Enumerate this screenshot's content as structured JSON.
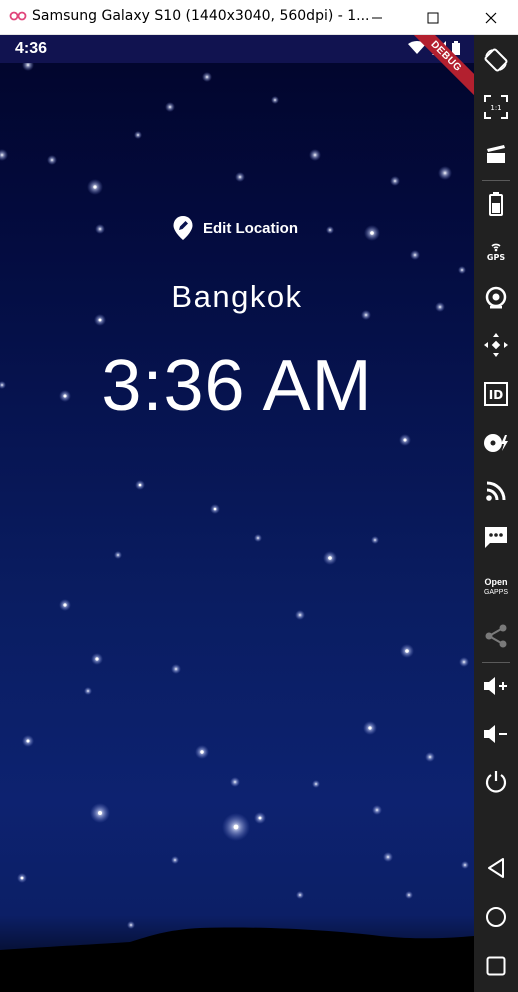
{
  "window": {
    "title": "Samsung Galaxy S10 (1440x3040, 560dpi) - 1...",
    "minimize_icon": "minimize-icon",
    "maximize_icon": "maximize-icon",
    "close_icon": "close-icon"
  },
  "status_bar": {
    "time": "4:36",
    "icons": [
      "wifi-icon",
      "signal-icon",
      "battery-icon"
    ],
    "debug_banner": "DEBUG",
    "debug_color": "#b3202f"
  },
  "app": {
    "edit_location_label": "Edit Location",
    "city": "Bangkok",
    "time": "3:36 AM",
    "background_colors": [
      "#02052b",
      "#0d2270"
    ]
  },
  "toolbar": {
    "items": [
      {
        "name": "rotate",
        "icon": "rotate-icon"
      },
      {
        "name": "fullscreen",
        "icon": "fullscreen-icon",
        "text": "1:1"
      },
      {
        "name": "screen-record",
        "icon": "clapperboard-icon"
      },
      {
        "name": "battery",
        "icon": "battery-icon"
      },
      {
        "name": "gps",
        "icon": "gps-icon",
        "text": "GPS"
      },
      {
        "name": "camera",
        "icon": "webcam-icon"
      },
      {
        "name": "move",
        "icon": "move-icon"
      },
      {
        "name": "identifiers",
        "icon": "id-icon",
        "text": "ID"
      },
      {
        "name": "disk",
        "icon": "disk-icon"
      },
      {
        "name": "network",
        "icon": "rss-icon"
      },
      {
        "name": "sms",
        "icon": "message-icon"
      },
      {
        "name": "open-gapps",
        "icon": "opengapps-icon",
        "text_line1": "Open",
        "text_line2": "GAPPS"
      },
      {
        "name": "share",
        "icon": "share-icon"
      },
      {
        "name": "volume-up",
        "icon": "volume-up-icon"
      },
      {
        "name": "volume-down",
        "icon": "volume-down-icon"
      },
      {
        "name": "power",
        "icon": "power-icon"
      },
      {
        "name": "back",
        "icon": "back-triangle-icon"
      },
      {
        "name": "home",
        "icon": "home-circle-icon"
      },
      {
        "name": "recents",
        "icon": "recents-square-icon"
      }
    ]
  }
}
